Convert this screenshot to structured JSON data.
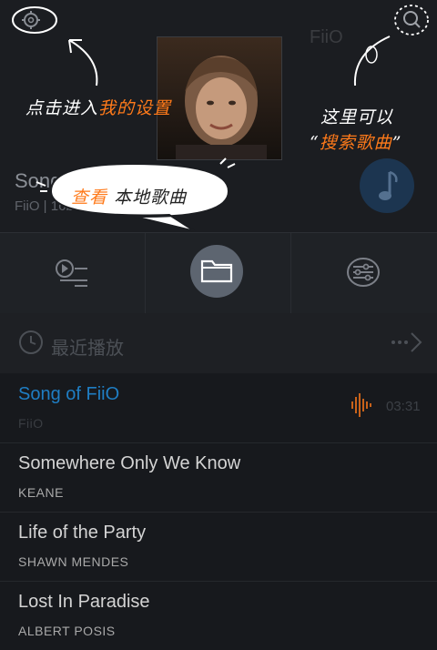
{
  "header": {
    "ghost_title": "FiiO",
    "now_playing": {
      "title": "Song of FiiO",
      "meta": "FiiO | 16bits | 320kbps"
    }
  },
  "annotations": {
    "settings": {
      "white": "点击进入",
      "orange": "我的设置"
    },
    "search_line1": "这里可以",
    "search_line2": {
      "open": "“",
      "orange": "搜索歌曲",
      "close": "”"
    },
    "local": {
      "orange": "查看",
      "white": "本地歌曲"
    }
  },
  "tabs": [
    {
      "name": "playlist-tab",
      "icon": "playlist-icon"
    },
    {
      "name": "folder-tab",
      "icon": "folder-icon"
    },
    {
      "name": "equalizer-tab",
      "icon": "equalizer-icon"
    }
  ],
  "recent": {
    "label": "最近播放",
    "more": "···"
  },
  "songs": [
    {
      "title": "Song of FiiO",
      "artist": "FiiO",
      "duration": "03:31",
      "playing": true
    },
    {
      "title": "Somewhere Only We Know",
      "artist": "KEANE"
    },
    {
      "title": "Life of the Party",
      "artist": "SHAWN MENDES"
    },
    {
      "title": "Lost In Paradise",
      "artist": "ALBERT POSIS"
    }
  ],
  "colors": {
    "accent_blue": "#1f7ec4",
    "annotation_orange": "#ff7a1a",
    "background": "#17191d"
  }
}
